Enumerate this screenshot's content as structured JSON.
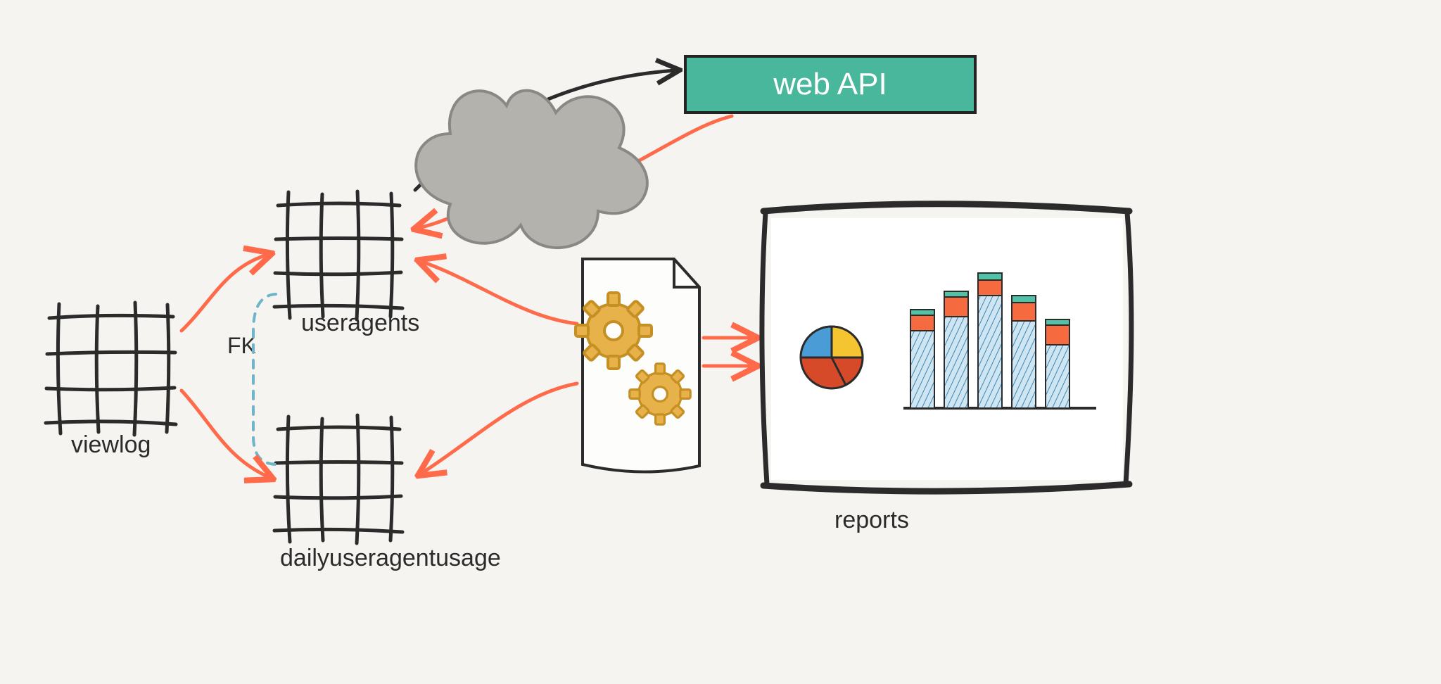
{
  "nodes": {
    "viewlog": {
      "label": "viewlog"
    },
    "useragents": {
      "label": "useragents"
    },
    "dailyuseragentusage": {
      "label": "dailyuseragentusage"
    },
    "reports": {
      "label": "reports"
    },
    "webapi": {
      "label": "web API"
    },
    "fk": {
      "label": "FK"
    }
  },
  "colors": {
    "ink": "#2b2b2b",
    "flow": "#ff6b4a",
    "teal": "#49b79b",
    "cloud": "#b4b2ad",
    "cloudEdge": "#8a8884",
    "gearFill": "#e7b24a",
    "gearEdge": "#c68f23",
    "pieYellow": "#f4c531",
    "pieBlue": "#4a9cd6",
    "pieRed": "#d64a2a",
    "barBlue": "#5aa8d8",
    "barOrange": "#f56b3f",
    "barTeal": "#4fc2a7",
    "fkDash": "#6fb5c9"
  }
}
